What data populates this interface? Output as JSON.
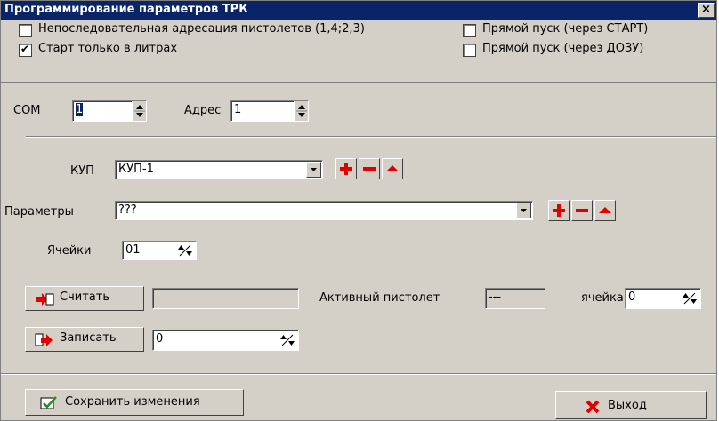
{
  "window": {
    "title": "Программирование параметров ТРК",
    "close_glyph": "×"
  },
  "options": {
    "nonseq_addressing": {
      "label": "Непоследовательная адресация пистолетов (1,4;2,3)",
      "checked": false
    },
    "start_liters_only": {
      "label": "Старт только в литрах",
      "checked": true
    },
    "direct_start_start": {
      "label": "Прямой пуск (через СТАРТ)",
      "checked": false
    },
    "direct_start_dozu": {
      "label": "Прямой пуск (через ДОЗУ)",
      "checked": false
    }
  },
  "connection": {
    "com_label": "COM",
    "com_value": "1",
    "address_label": "Адрес",
    "address_value": "1"
  },
  "kup": {
    "label": "КУП",
    "value": "КУП-1"
  },
  "params": {
    "label": "Параметры",
    "value": "???"
  },
  "cells": {
    "label": "Ячейки",
    "value": "01"
  },
  "read": {
    "button_label": "Считать",
    "value": ""
  },
  "active_pistol": {
    "label": "Активный пистолет",
    "value": "---",
    "cell_label": "ячейка",
    "cell_value": "0"
  },
  "write": {
    "button_label": "Записать",
    "value": "0"
  },
  "footer": {
    "save_label": "Сохранить изменения",
    "exit_label": "Выход"
  },
  "colors": {
    "accent_red": "#e00000",
    "title_bar": "#0a246a",
    "face": "#d4d0c8"
  },
  "icons": {
    "add": "plus-icon",
    "remove": "minus-icon",
    "up": "triangle-up-icon",
    "read": "read-arrow-icon",
    "write": "write-arrow-icon",
    "save": "save-check-icon",
    "exit": "red-x-icon"
  }
}
